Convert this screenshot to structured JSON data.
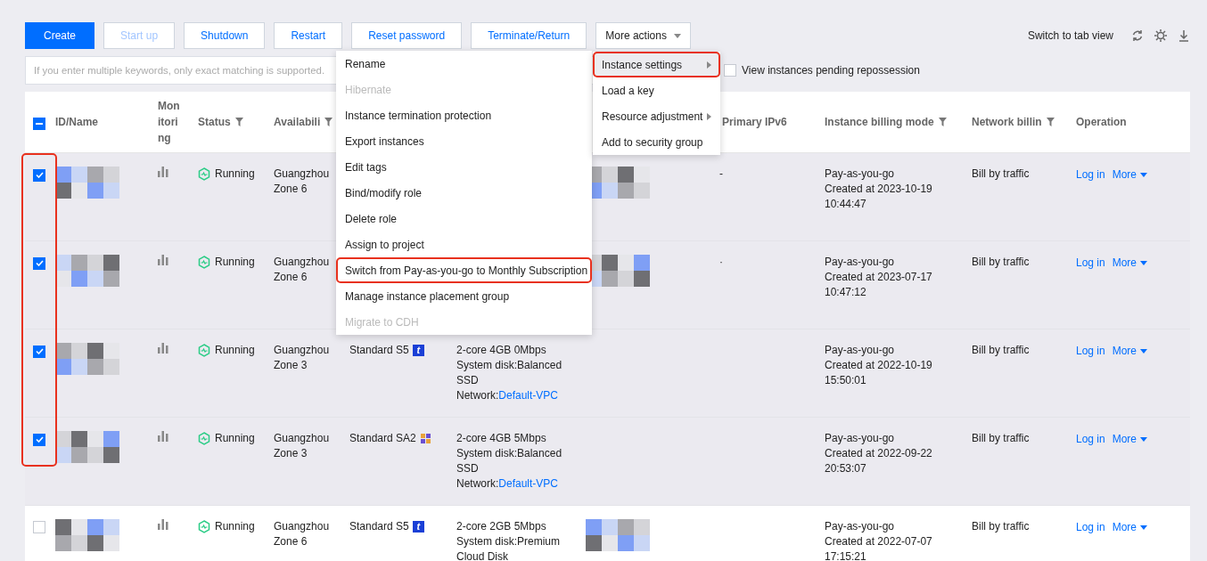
{
  "toolbar": {
    "buttons": [
      {
        "label": "Create",
        "kind": "primary",
        "disabled": false
      },
      {
        "label": "Start up",
        "kind": "default",
        "disabled": true
      },
      {
        "label": "Shutdown",
        "kind": "default",
        "disabled": false
      },
      {
        "label": "Restart",
        "kind": "default",
        "disabled": false
      },
      {
        "label": "Reset password",
        "kind": "default",
        "disabled": false
      },
      {
        "label": "Terminate/Return",
        "kind": "default",
        "disabled": false
      }
    ],
    "more_actions": {
      "label": "More actions",
      "expanded": true
    },
    "switch_view": "Switch to tab view"
  },
  "search": {
    "placeholder": "If you enter multiple keywords, only exact matching is supported."
  },
  "pending_filter": {
    "label": "View instances pending repossession",
    "checked": false
  },
  "table": {
    "select_all": {
      "indeterminate": true
    },
    "columns_left": [
      {
        "label": "ID/Name",
        "filter": false
      },
      {
        "label": "Monitoring",
        "filter": false
      },
      {
        "label": "Status",
        "filter": true
      },
      {
        "label": "Availabili",
        "filter": true
      }
    ],
    "columns_right": [
      {
        "label": "Primary IPv6",
        "filter": false
      },
      {
        "label": "Instance billing mode",
        "filter": true
      },
      {
        "label": "Network billin",
        "filter": true
      },
      {
        "label": "Operation",
        "filter": false
      }
    ],
    "rows": [
      {
        "selected": true,
        "annotated": true,
        "status": "Running",
        "zone": [
          "Guangzhou",
          "Zone 6"
        ],
        "ip_redacted": true,
        "ipv6": "-",
        "billing": [
          "Pay-as-you-go",
          "Created at 2023-10-19",
          "10:44:47"
        ],
        "network_billing": "Bill by traffic",
        "actions": {
          "login": "Log in",
          "more": "More"
        }
      },
      {
        "selected": true,
        "annotated": true,
        "status": "Running",
        "zone": [
          "Guangzhou",
          "Zone 6"
        ],
        "ip_redacted": true,
        "ipv6": "·",
        "billing": [
          "Pay-as-you-go",
          "Created at 2023-07-17",
          "10:47:12"
        ],
        "network_billing": "Bill by traffic",
        "actions": {
          "login": "Log in",
          "more": "More"
        }
      },
      {
        "selected": true,
        "annotated": true,
        "status": "Running",
        "zone": [
          "Guangzhou",
          "Zone 3"
        ],
        "model": "Standard S5",
        "model_badge": "t",
        "config": [
          "2-core 4GB 0Mbps",
          "System disk:Balanced",
          "SSD"
        ],
        "network_label": "Network:",
        "network_link": "Default-VPC",
        "ip_redacted": false,
        "billing": [
          "Pay-as-you-go",
          "Created at 2022-10-19",
          "15:50:01"
        ],
        "network_billing": "Bill by traffic",
        "actions": {
          "login": "Log in",
          "more": "More"
        }
      },
      {
        "selected": true,
        "annotated": true,
        "status": "Running",
        "zone": [
          "Guangzhou",
          "Zone 3"
        ],
        "model": "Standard SA2",
        "chip_icon": true,
        "config": [
          "2-core 4GB 5Mbps",
          "System disk:Balanced",
          "SSD"
        ],
        "network_label": "Network:",
        "network_link": "Default-VPC",
        "ip_redacted": false,
        "billing": [
          "Pay-as-you-go",
          "Created at 2022-09-22",
          "20:53:07"
        ],
        "network_billing": "Bill by traffic",
        "actions": {
          "login": "Log in",
          "more": "More"
        }
      },
      {
        "selected": false,
        "annotated": false,
        "status": "Running",
        "zone": [
          "Guangzhou",
          "Zone 6"
        ],
        "model": "Standard S5",
        "model_badge": "t",
        "config": [
          "2-core 2GB 5Mbps",
          "System disk:Premium",
          "Cloud Disk"
        ],
        "ip_redacted": true,
        "billing": [
          "Pay-as-you-go",
          "Created at 2022-07-07",
          "17:15:21"
        ],
        "network_billing": "Bill by traffic",
        "actions": {
          "login": "Log in",
          "more": "More"
        }
      }
    ]
  },
  "actions_menu": {
    "items": [
      {
        "label": "Rename",
        "disabled": false,
        "annotated": false
      },
      {
        "label": "Hibernate",
        "disabled": true,
        "annotated": false
      },
      {
        "label": "Instance termination protection",
        "disabled": false,
        "annotated": false
      },
      {
        "label": "Export instances",
        "disabled": false,
        "annotated": false
      },
      {
        "label": "Edit tags",
        "disabled": false,
        "annotated": false
      },
      {
        "label": "Bind/modify role",
        "disabled": false,
        "annotated": false
      },
      {
        "label": "Delete role",
        "disabled": false,
        "annotated": false
      },
      {
        "label": "Assign to project",
        "disabled": false,
        "annotated": false
      },
      {
        "label": "Switch from Pay-as-you-go to Monthly Subscription",
        "disabled": false,
        "annotated": true
      },
      {
        "label": "Manage instance placement group",
        "disabled": false,
        "annotated": false
      },
      {
        "label": "Migrate to CDH",
        "disabled": true,
        "annotated": false
      }
    ]
  },
  "more_menu": {
    "items": [
      {
        "label": "Instance settings",
        "submenu": true,
        "selected": true,
        "annotated": true
      },
      {
        "label": "Load a key",
        "submenu": false,
        "selected": false,
        "annotated": false
      },
      {
        "label": "Resource adjustment",
        "submenu": true,
        "selected": false,
        "annotated": false
      },
      {
        "label": "Add to security group",
        "submenu": false,
        "selected": false,
        "annotated": false
      }
    ]
  }
}
